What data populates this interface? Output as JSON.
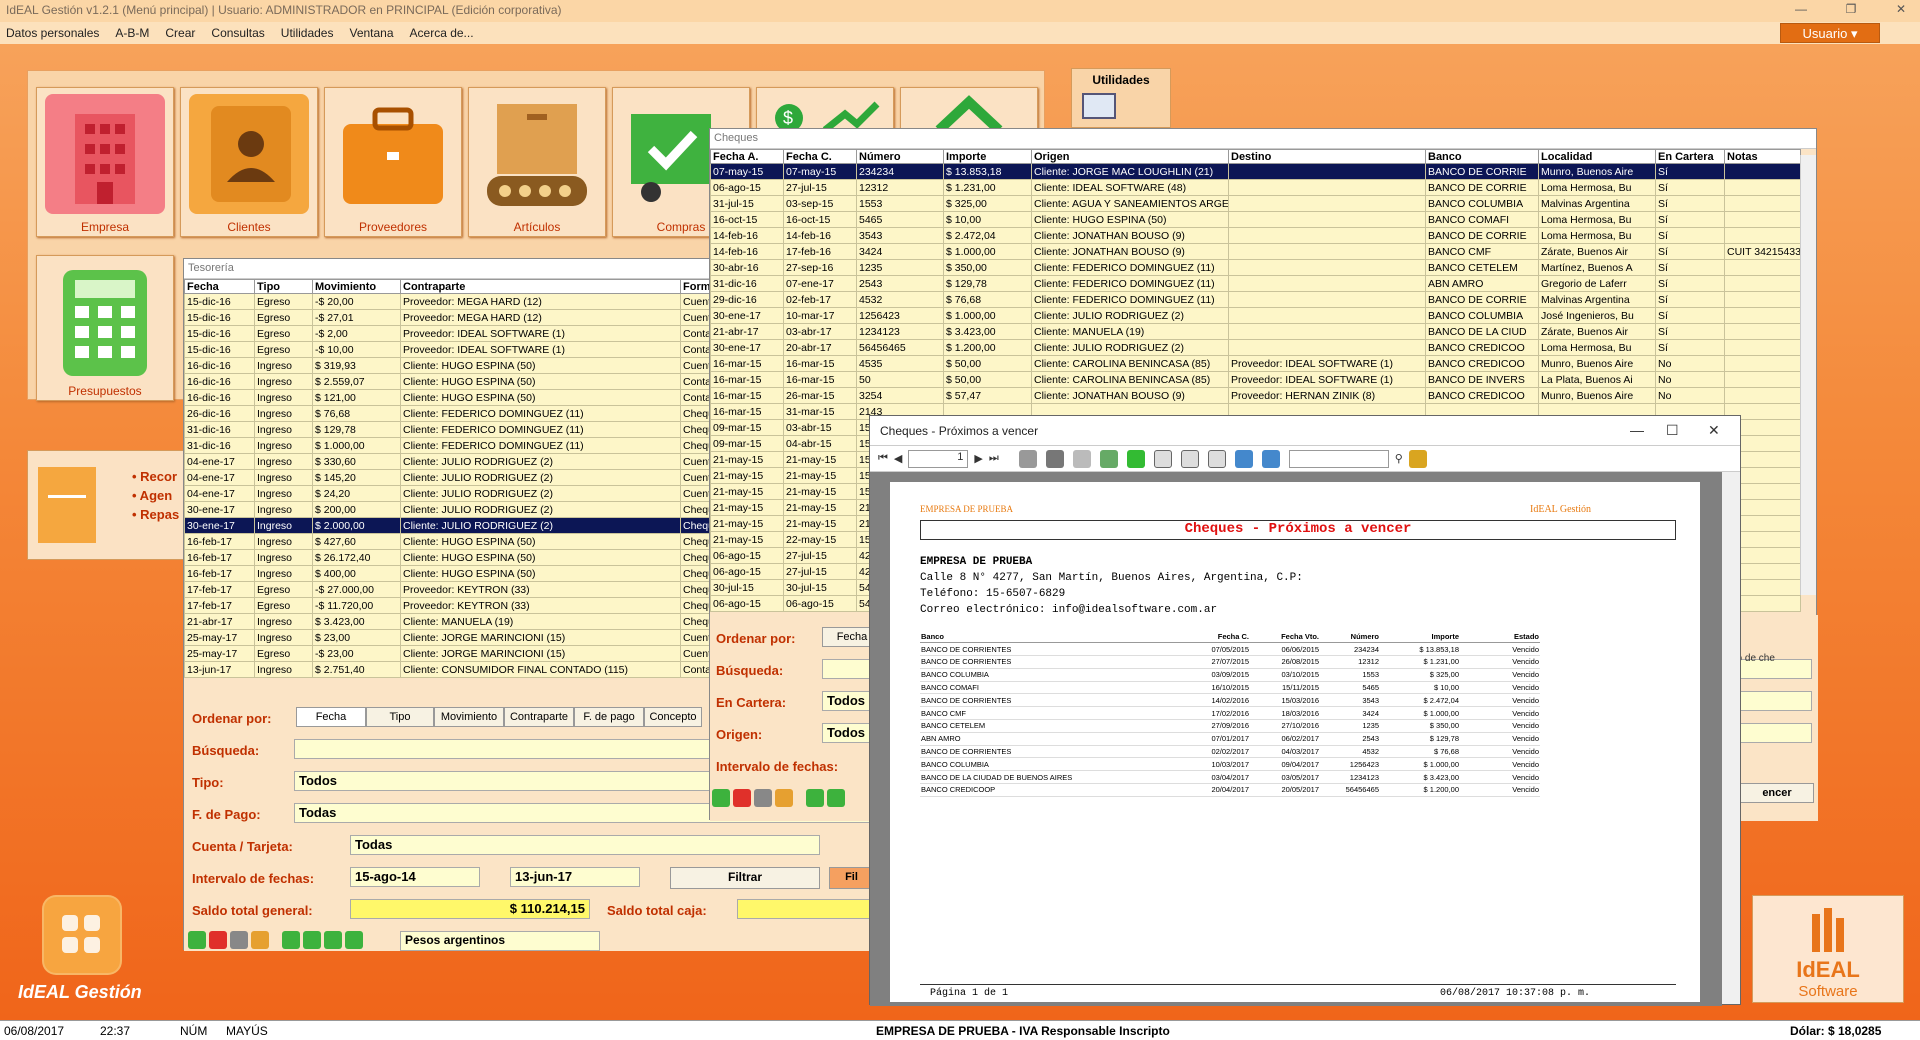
{
  "titlebar": {
    "title": "IdEAL Gestión v1.2.1 (Menú principal) | Usuario: ADMINISTRADOR en PRINCIPAL (Edición corporativa)"
  },
  "menu": [
    "Datos personales",
    "A-B-M",
    "Crear",
    "Consultas",
    "Utilidades",
    "Ventana",
    "Acerca de..."
  ],
  "user_button": "Usuario ▾",
  "tiles": [
    {
      "label": "Empresa"
    },
    {
      "label": "Clientes"
    },
    {
      "label": "Proveedores"
    },
    {
      "label": "Artículos"
    },
    {
      "label": "Compras"
    },
    {
      "label": ""
    },
    {
      "label": ""
    },
    {
      "label": "Presupuestos"
    }
  ],
  "utilidades": {
    "title": "Utilidades"
  },
  "left_card": {
    "items": [
      "• Recor",
      "• Agen",
      "• Repas"
    ]
  },
  "brand": {
    "app": "IdEAL Gestión",
    "logo_line1": "IdEAL",
    "logo_line2": "Software"
  },
  "tesoreria": {
    "title": "Tesorería",
    "columns": [
      "Fecha",
      "Tipo",
      "Movimiento",
      "Contraparte",
      "Forma"
    ],
    "rows": [
      [
        "15-dic-16",
        "Egreso",
        "-$ 20,00",
        "Proveedor: MEGA HARD (12)",
        "Cuenta"
      ],
      [
        "15-dic-16",
        "Egreso",
        "-$ 27,01",
        "Proveedor: MEGA HARD (12)",
        "Cuenta"
      ],
      [
        "15-dic-16",
        "Egreso",
        "-$ 2,00",
        "Proveedor: IDEAL SOFTWARE (1)",
        "Contado"
      ],
      [
        "15-dic-16",
        "Egreso",
        "-$ 10,00",
        "Proveedor: IDEAL SOFTWARE (1)",
        "Contado"
      ],
      [
        "16-dic-16",
        "Ingreso",
        "$ 319,93",
        "Cliente: HUGO ESPINA (50)",
        "Cuenta"
      ],
      [
        "16-dic-16",
        "Ingreso",
        "$ 2.559,07",
        "Cliente: HUGO ESPINA (50)",
        "Contado"
      ],
      [
        "16-dic-16",
        "Ingreso",
        "$ 121,00",
        "Cliente: HUGO ESPINA (50)",
        "Contado"
      ],
      [
        "26-dic-16",
        "Ingreso",
        "$ 76,68",
        "Cliente: FEDERICO DOMINGUEZ (11)",
        "Cheque"
      ],
      [
        "31-dic-16",
        "Ingreso",
        "$ 129,78",
        "Cliente: FEDERICO DOMINGUEZ (11)",
        "Cheque"
      ],
      [
        "31-dic-16",
        "Ingreso",
        "$ 1.000,00",
        "Cliente: FEDERICO DOMINGUEZ (11)",
        "Cheque"
      ],
      [
        "04-ene-17",
        "Ingreso",
        "$ 330,60",
        "Cliente: JULIO RODRIGUEZ (2)",
        "Cuenta"
      ],
      [
        "04-ene-17",
        "Ingreso",
        "$ 145,20",
        "Cliente: JULIO RODRIGUEZ (2)",
        "Cuenta"
      ],
      [
        "04-ene-17",
        "Ingreso",
        "$ 24,20",
        "Cliente: JULIO RODRIGUEZ (2)",
        "Cuenta"
      ],
      [
        "30-ene-17",
        "Ingreso",
        "$ 200,00",
        "Cliente: JULIO RODRIGUEZ (2)",
        "Cheque"
      ],
      [
        "30-ene-17",
        "Ingreso",
        "$ 2.000,00",
        "Cliente: JULIO RODRIGUEZ (2)",
        "Cheque"
      ],
      [
        "16-feb-17",
        "Ingreso",
        "$ 427,60",
        "Cliente: HUGO ESPINA (50)",
        "Cheque"
      ],
      [
        "16-feb-17",
        "Ingreso",
        "$ 26.172,40",
        "Cliente: HUGO ESPINA (50)",
        "Cheque"
      ],
      [
        "16-feb-17",
        "Ingreso",
        "$ 400,00",
        "Cliente: HUGO ESPINA (50)",
        "Cheque"
      ],
      [
        "17-feb-17",
        "Egreso",
        "-$ 27.000,00",
        "Proveedor: KEYTRON (33)",
        "Cheque"
      ],
      [
        "17-feb-17",
        "Egreso",
        "-$ 11.720,00",
        "Proveedor: KEYTRON (33)",
        "Cheque"
      ],
      [
        "21-abr-17",
        "Ingreso",
        "$ 3.423,00",
        "Cliente: MANUELA (19)",
        "Cheque"
      ],
      [
        "25-may-17",
        "Ingreso",
        "$ 23,00",
        "Cliente: JORGE MARINCIONI (15)",
        "Cuenta"
      ],
      [
        "25-may-17",
        "Egreso",
        "-$ 23,00",
        "Cliente: JORGE MARINCIONI (15)",
        "Cuenta"
      ],
      [
        "13-jun-17",
        "Ingreso",
        "$ 2.751,40",
        "Cliente: CONSUMIDOR FINAL CONTADO (115)",
        "Contado"
      ]
    ],
    "selected_row": 14,
    "order_label": "Ordenar por:",
    "order_tabs": [
      "Fecha",
      "Tipo",
      "Movimiento",
      "Contraparte",
      "F. de pago",
      "Concepto"
    ],
    "busqueda_label": "Búsqueda:",
    "tipo_label": "Tipo:",
    "tipo_value": "Todos",
    "fpago_label": "F. de Pago:",
    "fpago_value": "Todas",
    "cuenta_label": "Cuenta / Tarjeta:",
    "cuenta_value": "Todas",
    "intervalo_label": "Intervalo de fechas:",
    "fecha_desde": "15-ago-14",
    "fecha_hasta": "13-jun-17",
    "filtrar": "Filtrar",
    "filtrar2": "Fil",
    "saldo_label": "Saldo total general:",
    "saldo_value": "$ 110.214,15",
    "saldo_caja_label": "Saldo total caja:",
    "moneda": "Pesos argentinos"
  },
  "cheques": {
    "title": "Cheques",
    "columns": [
      "Fecha A.",
      "Fecha C.",
      "Número",
      "Importe",
      "Origen",
      "Destino",
      "Banco",
      "Localidad",
      "En Cartera",
      "Notas"
    ],
    "rows": [
      [
        "07-may-15",
        "07-may-15",
        "234234",
        "$ 13.853,18",
        "Cliente: JORGE MAC LOUGHLIN (21)",
        "",
        "BANCO DE CORRIE",
        "Munro, Buenos Aire",
        "Sí",
        ""
      ],
      [
        "06-ago-15",
        "27-jul-15",
        "12312",
        "$ 1.231,00",
        "Cliente: IDEAL SOFTWARE (48)",
        "",
        "BANCO DE CORRIE",
        "Loma Hermosa, Bu",
        "Sí",
        ""
      ],
      [
        "31-jul-15",
        "03-sep-15",
        "1553",
        "$ 325,00",
        "Cliente: AGUA Y SANEAMIENTOS ARGE",
        "",
        "BANCO COLUMBIA",
        "Malvinas Argentina",
        "Sí",
        ""
      ],
      [
        "16-oct-15",
        "16-oct-15",
        "5465",
        "$ 10,00",
        "Cliente: HUGO ESPINA (50)",
        "",
        "BANCO COMAFI",
        "Loma Hermosa, Bu",
        "Sí",
        ""
      ],
      [
        "14-feb-16",
        "14-feb-16",
        "3543",
        "$ 2.472,04",
        "Cliente: JONATHAN BOUSO (9)",
        "",
        "BANCO DE CORRIE",
        "Loma Hermosa, Bu",
        "Sí",
        ""
      ],
      [
        "14-feb-16",
        "17-feb-16",
        "3424",
        "$ 1.000,00",
        "Cliente: JONATHAN BOUSO (9)",
        "",
        "BANCO CMF",
        "Zárate, Buenos Air",
        "Sí",
        "CUIT 34215433"
      ],
      [
        "30-abr-16",
        "27-sep-16",
        "1235",
        "$ 350,00",
        "Cliente: FEDERICO DOMINGUEZ (11)",
        "",
        "BANCO CETELEM",
        "Martínez, Buenos A",
        "Sí",
        ""
      ],
      [
        "31-dic-16",
        "07-ene-17",
        "2543",
        "$ 129,78",
        "Cliente: FEDERICO DOMINGUEZ (11)",
        "",
        "ABN AMRO",
        "Gregorio de Laferr",
        "Sí",
        ""
      ],
      [
        "29-dic-16",
        "02-feb-17",
        "4532",
        "$ 76,68",
        "Cliente: FEDERICO DOMINGUEZ (11)",
        "",
        "BANCO DE CORRIE",
        "Malvinas Argentina",
        "Sí",
        ""
      ],
      [
        "30-ene-17",
        "10-mar-17",
        "1256423",
        "$ 1.000,00",
        "Cliente: JULIO RODRIGUEZ (2)",
        "",
        "BANCO COLUMBIA",
        "José Ingenieros, Bu",
        "Sí",
        ""
      ],
      [
        "21-abr-17",
        "03-abr-17",
        "1234123",
        "$ 3.423,00",
        "Cliente: MANUELA (19)",
        "",
        "BANCO DE LA CIUD",
        "Zárate, Buenos Air",
        "Sí",
        ""
      ],
      [
        "30-ene-17",
        "20-abr-17",
        "56456465",
        "$ 1.200,00",
        "Cliente: JULIO RODRIGUEZ (2)",
        "",
        "BANCO CREDICOO",
        "Loma Hermosa, Bu",
        "Sí",
        ""
      ],
      [
        "16-mar-15",
        "16-mar-15",
        "4535",
        "$ 50,00",
        "Cliente: CAROLINA BENINCASA (85)",
        "Proveedor: IDEAL SOFTWARE (1)",
        "BANCO CREDICOO",
        "Munro, Buenos Aire",
        "No",
        ""
      ],
      [
        "16-mar-15",
        "16-mar-15",
        "50",
        "$ 50,00",
        "Cliente: CAROLINA BENINCASA (85)",
        "Proveedor: IDEAL SOFTWARE (1)",
        "BANCO DE INVERS",
        "La Plata, Buenos Ai",
        "No",
        ""
      ],
      [
        "16-mar-15",
        "26-mar-15",
        "3254",
        "$ 57,47",
        "Cliente: JONATHAN BOUSO (9)",
        "Proveedor: HERNAN ZINIK (8)",
        "BANCO CREDICOO",
        "Munro, Buenos Aire",
        "No",
        ""
      ]
    ],
    "partial_rows": [
      [
        "16-mar-15",
        "31-mar-15",
        "2143"
      ],
      [
        "09-mar-15",
        "03-abr-15",
        "15"
      ],
      [
        "09-mar-15",
        "04-abr-15",
        "15"
      ],
      [
        "21-may-15",
        "21-may-15",
        "15"
      ],
      [
        "21-may-15",
        "21-may-15",
        "15"
      ],
      [
        "21-may-15",
        "21-may-15",
        "15"
      ],
      [
        "21-may-15",
        "21-may-15",
        "21"
      ],
      [
        "21-may-15",
        "21-may-15",
        "21"
      ],
      [
        "21-may-15",
        "22-may-15",
        "15"
      ],
      [
        "06-ago-15",
        "27-jul-15",
        "42"
      ],
      [
        "06-ago-15",
        "27-jul-15",
        "42"
      ],
      [
        "30-jul-15",
        "30-jul-15",
        "54"
      ],
      [
        "06-ago-15",
        "06-ago-15",
        "54"
      ]
    ],
    "form_right_1": "Fecha",
    "order_label": "Ordenar por:",
    "busqueda_label": "Búsqueda:",
    "cartera_label": "En Cartera:",
    "cartera_value": "Todos",
    "origen_label": "Origen:",
    "origen_value": "Todos",
    "intervalo_label": "Intervalo de fechas:",
    "notas_hint": "eso de che",
    "vencer_btn": "encer"
  },
  "report": {
    "title": "Cheques - Próximos a vencer",
    "page_input": "1",
    "company_small": "EMPRESA DE PRUEBA",
    "brand_small": "IdEAL Gestión",
    "heading": "Cheques - Próximos a vencer",
    "company": "EMPRESA DE PRUEBA",
    "address": "Calle 8 N° 4277, San Martín, Buenos Aires, Argentina, C.P:",
    "phone": "Teléfono: 15-6507-6829",
    "email": "Correo electrónico: info@idealsoftware.com.ar",
    "columns": [
      "Banco",
      "Fecha C.",
      "Fecha Vto.",
      "Número",
      "Importe",
      "Estado"
    ],
    "rows": [
      [
        "BANCO DE CORRIENTES",
        "07/05/2015",
        "06/06/2015",
        "234234",
        "$ 13.853,18",
        "Vencido"
      ],
      [
        "BANCO DE CORRIENTES",
        "27/07/2015",
        "26/08/2015",
        "12312",
        "$ 1.231,00",
        "Vencido"
      ],
      [
        "BANCO COLUMBIA",
        "03/09/2015",
        "03/10/2015",
        "1553",
        "$ 325,00",
        "Vencido"
      ],
      [
        "BANCO COMAFI",
        "16/10/2015",
        "15/11/2015",
        "5465",
        "$ 10,00",
        "Vencido"
      ],
      [
        "BANCO DE CORRIENTES",
        "14/02/2016",
        "15/03/2016",
        "3543",
        "$ 2.472,04",
        "Vencido"
      ],
      [
        "BANCO CMF",
        "17/02/2016",
        "18/03/2016",
        "3424",
        "$ 1.000,00",
        "Vencido"
      ],
      [
        "BANCO CETELEM",
        "27/09/2016",
        "27/10/2016",
        "1235",
        "$ 350,00",
        "Vencido"
      ],
      [
        "ABN AMRO",
        "07/01/2017",
        "06/02/2017",
        "2543",
        "$ 129,78",
        "Vencido"
      ],
      [
        "BANCO DE CORRIENTES",
        "02/02/2017",
        "04/03/2017",
        "4532",
        "$ 76,68",
        "Vencido"
      ],
      [
        "BANCO COLUMBIA",
        "10/03/2017",
        "09/04/2017",
        "1256423",
        "$ 1.000,00",
        "Vencido"
      ],
      [
        "BANCO DE LA CIUDAD DE BUENOS AIRES",
        "03/04/2017",
        "03/05/2017",
        "1234123",
        "$ 3.423,00",
        "Vencido"
      ],
      [
        "BANCO CREDICOOP",
        "20/04/2017",
        "20/05/2017",
        "56456465",
        "$ 1.200,00",
        "Vencido"
      ]
    ],
    "footer_page": "Página 1 de 1",
    "footer_date": "06/08/2017 10:37:08 p. m."
  },
  "statusbar": {
    "date": "06/08/2017",
    "time": "22:37",
    "num": "NÚM",
    "mayus": "MAYÚS",
    "company": "EMPRESA DE PRUEBA - IVA Responsable Inscripto",
    "dolar": "Dólar: $ 18,0285"
  },
  "colors": {
    "accent": "#f37a2a",
    "selection": "#0c1655",
    "grid_row": "#fdf6c8",
    "label_red": "#c03000"
  }
}
